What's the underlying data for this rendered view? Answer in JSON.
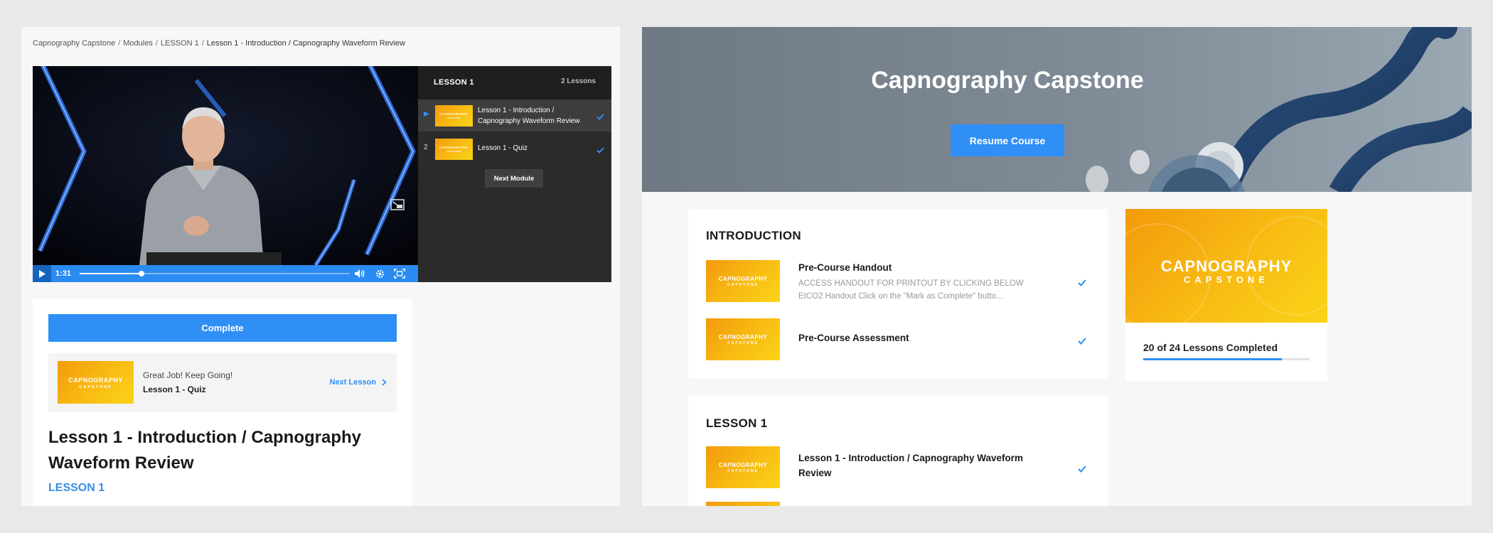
{
  "left": {
    "breadcrumb": [
      "Capnography Capstone",
      "Modules",
      "LESSON 1",
      "Lesson 1 - Introduction / Capnography Waveform Review"
    ],
    "breadcrumb_sep": "/",
    "player": {
      "time": "1:31",
      "progress": 0.23
    },
    "playlist": {
      "title": "LESSON 1",
      "count": "2 Lessons",
      "items": [
        {
          "index": "▶",
          "label": "Lesson 1 - Introduction / Capnography Waveform Review",
          "completed": true
        },
        {
          "index": "2",
          "label": "Lesson 1 - Quiz",
          "completed": true
        }
      ],
      "next_module": "Next Module"
    },
    "complete_button": "Complete",
    "next_box": {
      "encouragement": "Great Job! Keep Going!",
      "next_title": "Lesson 1 - Quiz",
      "link": "Next Lesson"
    },
    "lesson_title": "Lesson 1 - Introduction / Capnography Waveform Review",
    "lesson_module": "LESSON 1"
  },
  "right": {
    "hero_title": "Capnography Capstone",
    "resume_button": "Resume Course",
    "modules": [
      {
        "title": "INTRODUCTION",
        "items": [
          {
            "name": "Pre-Course Handout",
            "desc1": "ACCESS HANDOUT FOR PRINTOUT BY CLICKING BELOW",
            "desc2": "EtCO2 Handout Click on the \"Mark as Complete\" butto...",
            "completed": true
          },
          {
            "name": "Pre-Course Assessment",
            "completed": true
          }
        ]
      },
      {
        "title": "LESSON 1",
        "items": [
          {
            "name": "Lesson 1 - Introduction / Capnography Waveform Review",
            "completed": true
          }
        ]
      }
    ],
    "progress": {
      "text": "20 of 24 Lessons Completed",
      "completed": 20,
      "total": 24
    }
  },
  "brand": {
    "logo_line1": "CAPNOGRAPHY",
    "logo_line2": "CAPSTONE",
    "accent": "#2f8ff5",
    "accent_dark": "#1565c0",
    "logo_gradient": [
      "#f39a0c",
      "#fbd418"
    ]
  }
}
